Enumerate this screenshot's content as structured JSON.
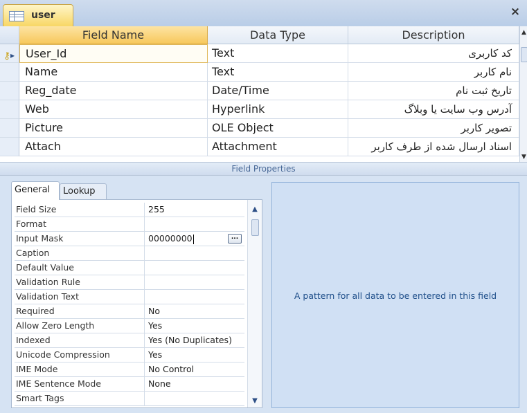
{
  "window": {
    "tab_label": "user",
    "close_symbol": "×"
  },
  "grid": {
    "headers": {
      "field_name": "Field Name",
      "data_type": "Data Type",
      "description": "Description"
    },
    "rows": [
      {
        "field": "User_Id",
        "type": "Text",
        "description": "کد کاربری",
        "primary_key": true,
        "current": true
      },
      {
        "field": "Name",
        "type": "Text",
        "description": "نام کاربر"
      },
      {
        "field": "Reg_date",
        "type": "Date/Time",
        "description": "تاریخ ثبت نام"
      },
      {
        "field": "Web",
        "type": "Hyperlink",
        "description": "آدرس وب سایت یا وبلاگ"
      },
      {
        "field": "Picture",
        "type": "OLE Object",
        "description": "تصویر کاربر"
      },
      {
        "field": "Attach",
        "type": "Attachment",
        "description": "اسناد ارسال شده از طرف کاربر"
      }
    ]
  },
  "field_properties": {
    "band_label": "Field Properties",
    "tabs": {
      "general": "General",
      "lookup": "Lookup"
    },
    "properties": [
      {
        "label": "Field Size",
        "value": "255"
      },
      {
        "label": "Format",
        "value": ""
      },
      {
        "label": "Input Mask",
        "value": "00000000",
        "active": true
      },
      {
        "label": "Caption",
        "value": ""
      },
      {
        "label": "Default Value",
        "value": ""
      },
      {
        "label": "Validation Rule",
        "value": ""
      },
      {
        "label": "Validation Text",
        "value": ""
      },
      {
        "label": "Required",
        "value": "No"
      },
      {
        "label": "Allow Zero Length",
        "value": "Yes"
      },
      {
        "label": "Indexed",
        "value": "Yes (No Duplicates)"
      },
      {
        "label": "Unicode Compression",
        "value": "Yes"
      },
      {
        "label": "IME Mode",
        "value": "No Control"
      },
      {
        "label": "IME Sentence Mode",
        "value": "None"
      },
      {
        "label": "Smart Tags",
        "value": ""
      }
    ],
    "builder_symbol": "..."
  },
  "help": {
    "text": "A pattern for all data to be entered in this field"
  },
  "icons": {
    "table": "table-icon",
    "close": "close-icon",
    "primary_key": "key-icon",
    "current_row": "current-row-arrow-icon",
    "builder": "builder-button-icon"
  }
}
